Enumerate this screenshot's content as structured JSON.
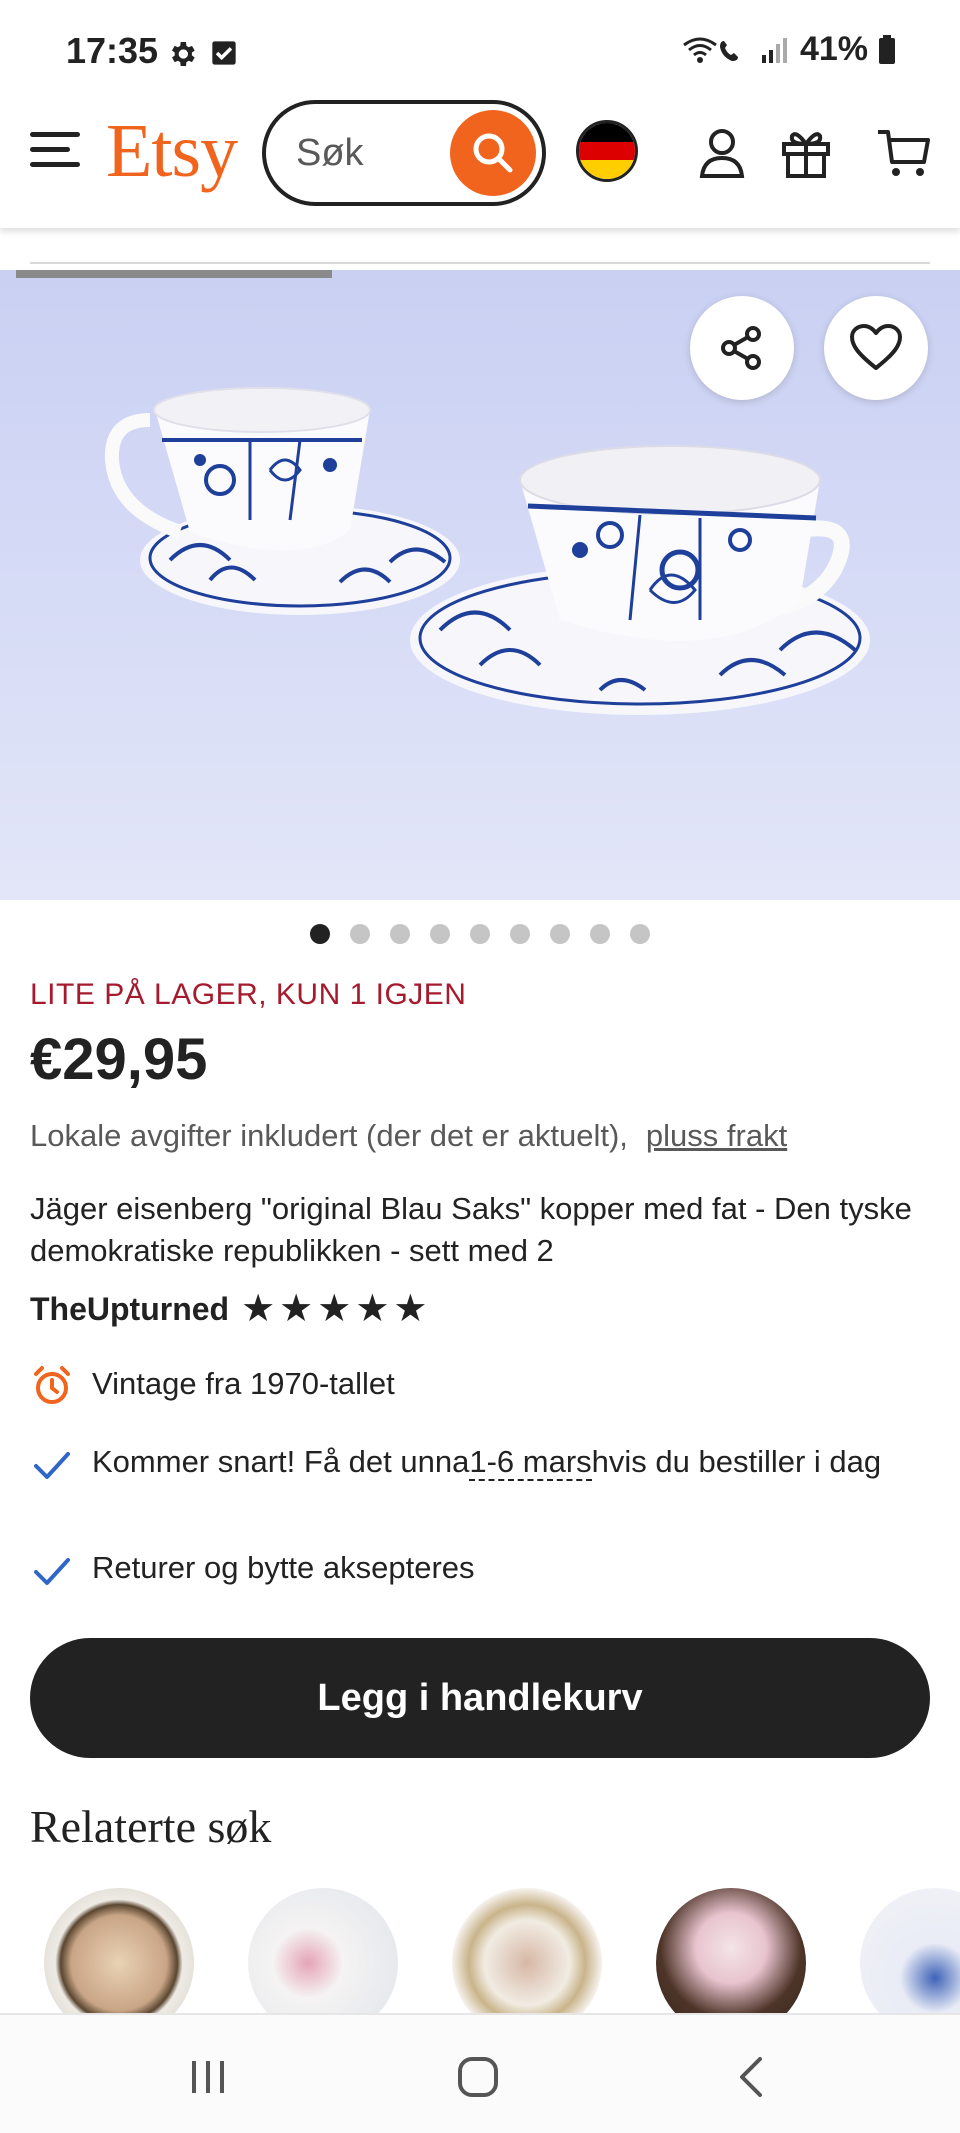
{
  "status_bar": {
    "time": "17:35",
    "battery": "41%",
    "icons": [
      "gear-icon",
      "check-square-icon",
      "wifi-call-icon",
      "signal-icon",
      "battery-icon"
    ]
  },
  "header": {
    "logo": "Etsy",
    "search": {
      "placeholder": "Søk"
    },
    "brand_color": "#F1641E",
    "icons": [
      "menu-icon",
      "search-icon",
      "germany-flag-icon",
      "account-icon",
      "gift-icon",
      "cart-icon"
    ]
  },
  "listing": {
    "image_count": 9,
    "active_image": 1,
    "stock_notice": "LITE PÅ LAGER, KUN 1 IGJEN",
    "price": "€29,95",
    "tax_note": "Lokale avgifter inkludert (der det er aktuelt),",
    "shipping_link": "pluss frakt",
    "title": "Jäger eisenberg \"original Blau Saks\" kopper med fat - Den tyske demokratiske republikken - sett med 2",
    "seller": "TheUpturned",
    "rating": 5,
    "rating_max": 5,
    "features": {
      "vintage": "Vintage fra 1970-tallet",
      "delivery_prefix": "Kommer snart! Få det unna",
      "delivery_dates": "1-6 mars",
      "delivery_suffix": "hvis du bestiller i dag",
      "returns": "Returer og bytte aksepteres"
    },
    "add_to_cart": "Legg i handlekurv",
    "stock_color": "#A61A2E"
  },
  "related": {
    "title": "Relaterte søk"
  },
  "nav_bar": {
    "icons": [
      "recent-apps-icon",
      "home-icon",
      "back-icon"
    ]
  }
}
